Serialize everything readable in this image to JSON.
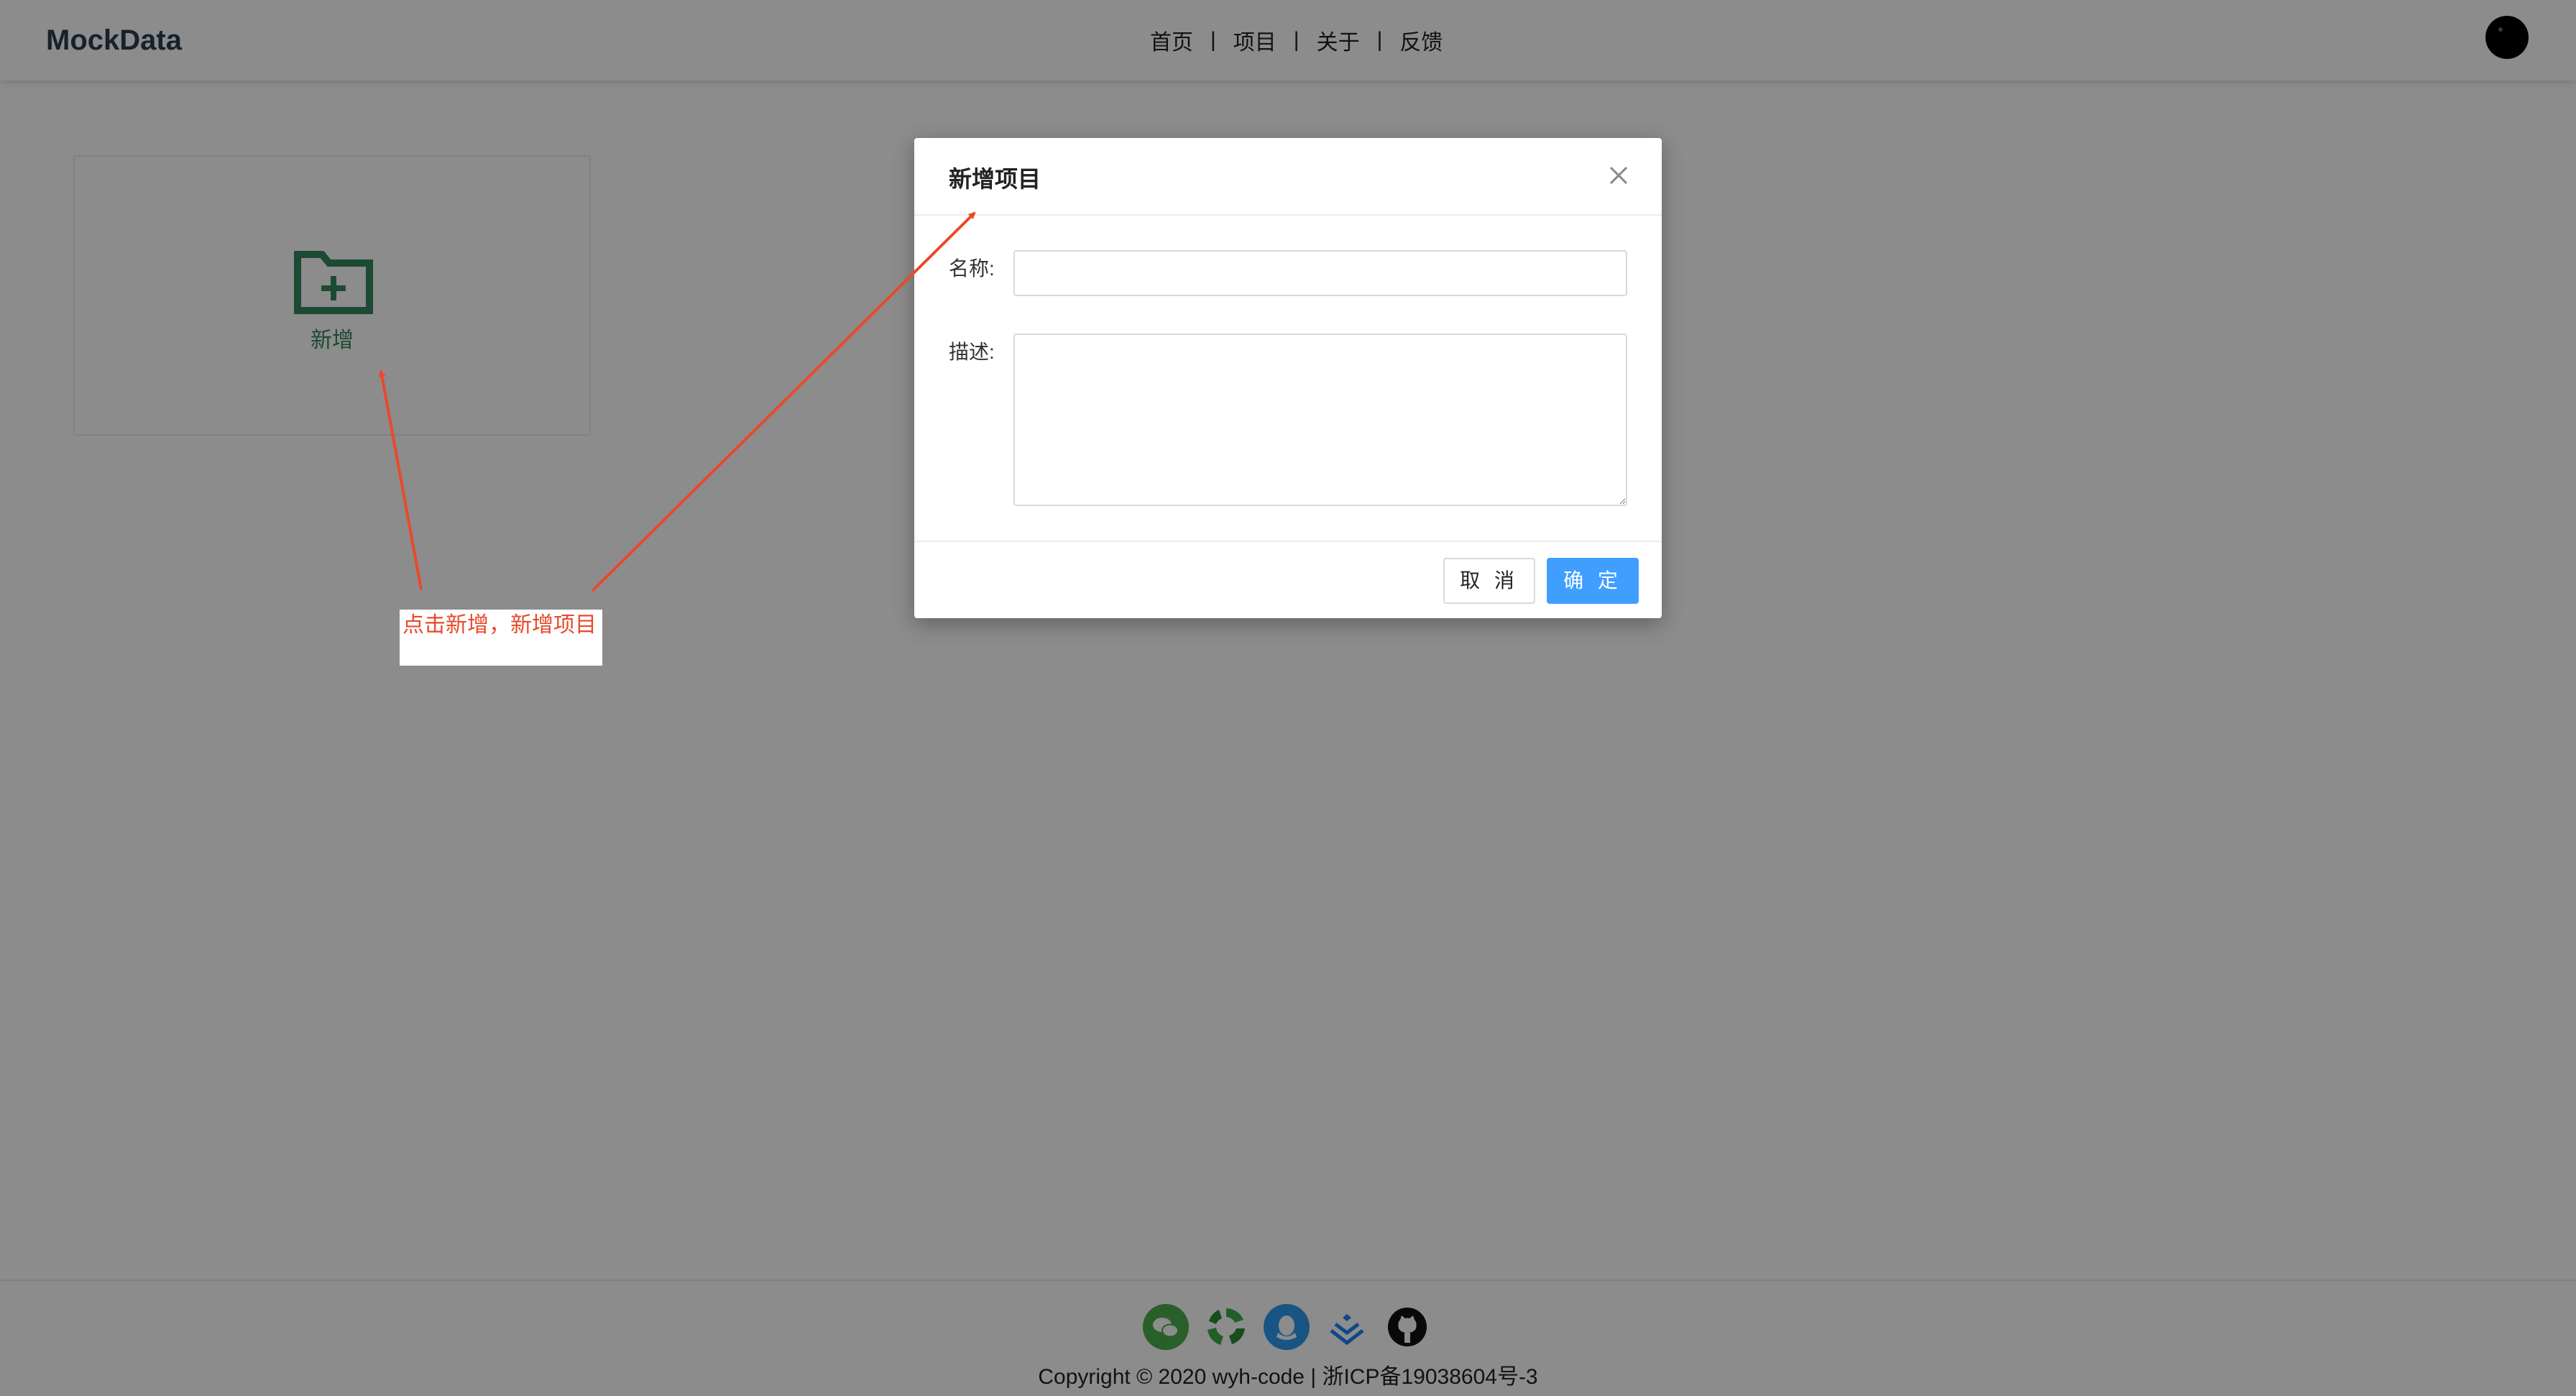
{
  "header": {
    "logo": "MockData",
    "nav": [
      {
        "label": "首页"
      },
      {
        "label": "项目"
      },
      {
        "label": "关于"
      },
      {
        "label": "反馈"
      }
    ],
    "separator": "|"
  },
  "main": {
    "add_card": {
      "label": "新增",
      "icon": "folder-add-icon",
      "accent_color": "#36875d"
    }
  },
  "annotation": {
    "text": "点击新增，新增项目",
    "color": "#e84a2a"
  },
  "modal": {
    "title": "新增项目",
    "name_label": "名称:",
    "name_value": "",
    "desc_label": "描述:",
    "desc_value": "",
    "cancel_label": "取 消",
    "ok_label": "确 定",
    "primary_color": "#409eff"
  },
  "footer": {
    "icons": [
      "wechat-icon",
      "recycle-icon",
      "qq-icon",
      "juejin-icon",
      "github-icon"
    ],
    "copyright": "Copyright © 2020 wyh-code | 浙ICP备19038604号-3"
  }
}
